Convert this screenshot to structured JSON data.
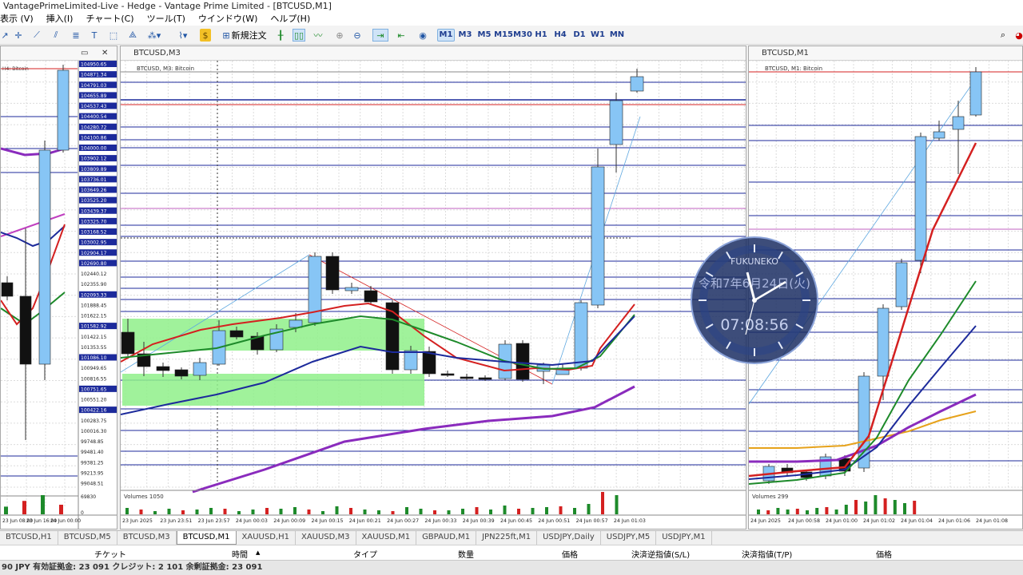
{
  "window": {
    "title": "VantagePrimeLimited-Live - Hedge - Vantage Prime Limited - [BTCUSD,M1]"
  },
  "menu": [
    "表示 (V)",
    "挿入(I)",
    "チャート(C)",
    "ツール(T)",
    "ウインドウ(W)",
    "ヘルプ(H)"
  ],
  "toolbar": {
    "new_order_label": "新規注文",
    "timeframes": [
      "M1",
      "M3",
      "M5",
      "M15",
      "M30",
      "H1",
      "H4",
      "D1",
      "W1",
      "MN"
    ],
    "active_timeframe": "M1"
  },
  "charts": {
    "left": {
      "title": "H4: Bitcoin",
      "price_labels": [
        "104950.65",
        "104871.34",
        "104791.03",
        "104655.89",
        "104537.43",
        "104400.54",
        "104280.72",
        "104100.86",
        "104000.00",
        "103902.12",
        "103809.89",
        "103736.01",
        "103649.26",
        "103525.20",
        "103439.37",
        "103325.70",
        "103168.52",
        "103002.95",
        "102904.17",
        "102690.80",
        "102440.12",
        "102355.90",
        "102093.33",
        "101888.45",
        "101622.15",
        "101582.92",
        "101422.15",
        "101353.55",
        "101086.10",
        "100949.65",
        "100816.55",
        "100751.65",
        "100551.20",
        "100422.16",
        "100283.75",
        "100016.30",
        "99748.85",
        "99481.40",
        "99381.25",
        "99213.95",
        "99048.51"
      ],
      "time_labels": [
        "23 Jun 08:00",
        "23 Jun 16:00",
        "24 Jun 00:00"
      ],
      "volume_scale": [
        "69830",
        "0"
      ]
    },
    "center": {
      "tab_title": "BTCUSD,M3",
      "title": "BTCUSD, M3: Bitcoin",
      "volume_label": "Volumes 1050",
      "time_labels": [
        "23 Jun 2025",
        "23 Jun 23:51",
        "23 Jun 23:57",
        "24 Jun 00:03",
        "24 Jun 00:09",
        "24 Jun 00:15",
        "24 Jun 00:21",
        "24 Jun 00:27",
        "24 Jun 00:33",
        "24 Jun 00:39",
        "24 Jun 00:45",
        "24 Jun 00:51",
        "24 Jun 00:57",
        "24 Jun 01:03"
      ]
    },
    "right": {
      "tab_title": "BTCUSD,M1",
      "title": "BTCUSD, M1: Bitcoin",
      "volume_label": "Volumes 299",
      "time_labels": [
        "24 Jun 2025",
        "24 Jun 00:58",
        "24 Jun 01:00",
        "24 Jun 01:02",
        "24 Jun 01:04",
        "24 Jun 01:06",
        "24 Jun 01:08"
      ]
    }
  },
  "clock": {
    "brand": "FUKUNEKO",
    "date": "令和7年6月24日(火)",
    "time": "07:08:56"
  },
  "tabs": [
    "BTCUSD,H1",
    "BTCUSD,M5",
    "BTCUSD,M3",
    "BTCUSD,M1",
    "XAUUSD,H1",
    "XAUUSD,M3",
    "XAUUSD,M1",
    "GBPAUD,M1",
    "JPN225ft,M1",
    "USDJPY,Daily",
    "USDJPY,M5",
    "USDJPY,M1"
  ],
  "active_tab": "BTCUSD,M1",
  "columns": {
    "ticket": "チケット",
    "time": "時間",
    "type": "タイプ",
    "volume": "数量",
    "price": "価格",
    "sl": "決済逆指値(S/L)",
    "tp": "決済指値(T/P)",
    "price2": "価格"
  },
  "status": "90 JPY  有効証拠金: 23 091  クレジット: 2 101  余剰証拠金: 23 091",
  "colors": {
    "bull": "#87c5f5",
    "bear": "#111111",
    "ma_red": "#d42020",
    "ma_green": "#1d8a2a",
    "ma_blue": "#1c2a9b",
    "ma_purple": "#8a2bbd",
    "zone": "#8ff08a"
  }
}
